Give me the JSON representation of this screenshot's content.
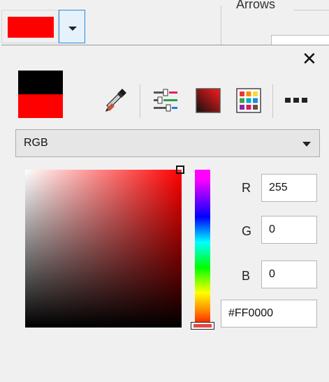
{
  "toolbar": {
    "current_color": "#ff0000",
    "group_label": "Arrows"
  },
  "picker": {
    "old_color": "#000000",
    "new_color": "#ff0000",
    "tools": [
      "eyedropper-icon",
      "sliders-icon",
      "color-gradient-icon",
      "palette-grid-icon",
      "more-icon"
    ],
    "mode": "RGB",
    "hue_color": "#ff0000",
    "channels": [
      {
        "label": "R",
        "value": "255"
      },
      {
        "label": "G",
        "value": "0"
      },
      {
        "label": "B",
        "value": "0"
      }
    ],
    "hex": "#FF0000"
  }
}
